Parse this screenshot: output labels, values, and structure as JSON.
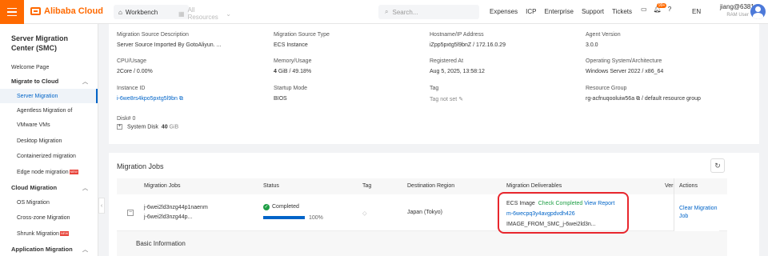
{
  "topbar": {
    "logo": "Alibaba Cloud",
    "workbench": "Workbench",
    "all_resources": "All Resources",
    "search_placeholder": "Search...",
    "links": [
      "Expenses",
      "ICP",
      "Enterprise",
      "Support",
      "Tickets"
    ],
    "notification_badge": "99+",
    "lang": "EN",
    "user_name": "jiang@6381...",
    "user_role": "RAM User"
  },
  "sidebar": {
    "title": "Server Migration Center (SMC)",
    "items": [
      {
        "label": "Welcome Page"
      },
      {
        "label": "Migrate to Cloud"
      },
      {
        "label": "Server Migration"
      },
      {
        "label": "Agentless Migration of"
      },
      {
        "label": "VMware VMs"
      },
      {
        "label": "Desktop Migration"
      },
      {
        "label": "Containerized migration"
      },
      {
        "label": "Edge node migration",
        "badge": "NEW"
      },
      {
        "label": "Cloud Migration"
      },
      {
        "label": "OS Migration"
      },
      {
        "label": "Cross-zone Migration"
      },
      {
        "label": "Shrunk Migration",
        "badge": "NEW"
      },
      {
        "label": "Application Migration"
      }
    ]
  },
  "source": {
    "desc_label": "Migration Source Description",
    "desc_value": "Server Source Imported By GotoAliyun. ...",
    "type_label": "Migration Source Type",
    "type_value": "ECS Instance",
    "host_label": "Hostname/IP Address",
    "host_value": "iZpp5pxtg5l9bnZ / 172.16.0.29",
    "agent_label": "Agent Version",
    "agent_value": "3.0.0",
    "cpu_label": "CPU/Usage",
    "cpu_value": "2Core / 0.00%",
    "mem_label": "Memory/Usage",
    "mem_num": "4",
    "mem_rest": " GiB / 49.18%",
    "reg_label": "Registered At",
    "reg_value": "Aug 5, 2025, 13:58:12",
    "os_label": "Operating System/Architecture",
    "os_value": "Windows Server 2022 / x86_64",
    "instance_label": "Instance ID",
    "instance_value": "i-6we8rs4kpo5pxtg5l9bn",
    "startup_label": "Startup Mode",
    "startup_value": "BIOS",
    "tag_label": "Tag",
    "tag_value": "Tag not set",
    "rg_label": "Resource Group",
    "rg_value": "rg-acfnuqooluiw56a",
    "rg_rest": " / default resource group",
    "disk_label": "Disk# 0",
    "disk_name": "System Disk",
    "disk_size": "40",
    "disk_unit": "GiB"
  },
  "jobs": {
    "title": "Migration Jobs",
    "columns": [
      "Migration Jobs",
      "Status",
      "Tag",
      "Destination Region",
      "Migration Deliverables",
      "Verif",
      "Actions"
    ],
    "row": {
      "job_id": "j-6wei2ld3nzg44p1naenm",
      "job_name": "j-6wei2ld3nzg44p...",
      "status": "Completed",
      "progress": 1.0,
      "progress_text": "100%",
      "region": "Japan (Tokyo)",
      "deliverable_type": "ECS Image",
      "check_text": "Check Completed",
      "view_report": "View Report",
      "image_id": "m-6wecpq3y4avgpdvdh426",
      "image_name": "IMAGE_FROM_SMC_j-6wei2ld3n...",
      "action": "Clear Migration Job"
    },
    "basic_info": "Basic Information"
  }
}
